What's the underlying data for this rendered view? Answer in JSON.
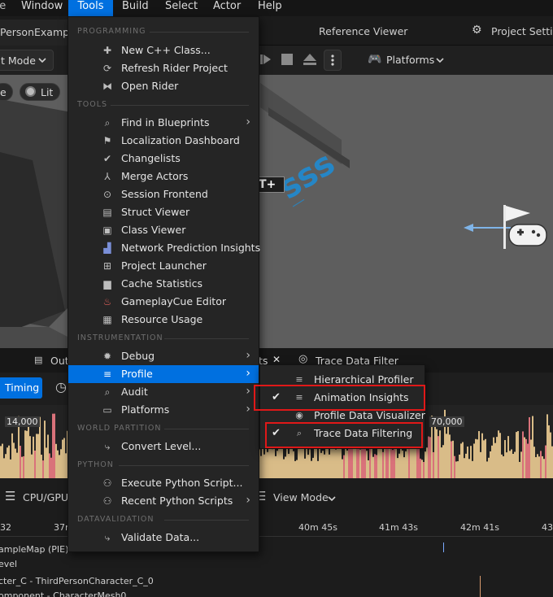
{
  "menubar": {
    "items": [
      {
        "label": "ile"
      },
      {
        "label": "Window"
      },
      {
        "label": "Tools"
      },
      {
        "label": "Build"
      },
      {
        "label": "Select"
      },
      {
        "label": "Actor"
      },
      {
        "label": "Help"
      }
    ]
  },
  "tabs": {
    "level": "PersonExample",
    "reference_viewer": "Reference Viewer",
    "project_settings": "Project Settin"
  },
  "toolbar": {
    "mode": "t Mode",
    "platforms": "Platforms"
  },
  "viewport": {
    "view_e": "e",
    "lit": "Lit",
    "text_bubble": "T+"
  },
  "bottom": {
    "tab_out": "Out",
    "tab_ts": "ts",
    "trace_tab": "Trace Data Filter",
    "timing": "Timing",
    "val_14000": "14,000",
    "val_70000": "70,000",
    "cpu_gpu": "CPU/GPU",
    "view_mode": "View Mode",
    "ticks": [
      "32",
      "37n",
      "40m 45s",
      "41m 43s",
      "42m 41s",
      "43"
    ],
    "rows": [
      "ampleMap (PIE)",
      "evel",
      "cter_C - ThirdPersonCharacter_C_0",
      "omponent - CharacterMesh0"
    ]
  },
  "tools_menu": {
    "sections": {
      "programming": "PROGRAMMING",
      "tools": "TOOLS",
      "instrumentation": "INSTRUMENTATION",
      "world_partition": "WORLD PARTITION",
      "python": "PYTHON",
      "datavalidation": "DATAVALIDATION"
    },
    "items": {
      "new_cpp": "New C++ Class...",
      "refresh_rider": "Refresh Rider Project",
      "open_rider": "Open Rider",
      "find_bp": "Find in Blueprints",
      "loc_dash": "Localization Dashboard",
      "changelists": "Changelists",
      "merge_actors": "Merge Actors",
      "session_frontend": "Session Frontend",
      "struct_viewer": "Struct Viewer",
      "class_viewer": "Class Viewer",
      "net_pred": "Network Prediction Insights",
      "project_launcher": "Project Launcher",
      "cache_stats": "Cache Statistics",
      "gameplaycue": "GameplayCue Editor",
      "resource_usage": "Resource Usage",
      "debug": "Debug",
      "profile": "Profile",
      "audit": "Audit",
      "platforms": "Platforms",
      "convert_level": "Convert Level...",
      "exec_python": "Execute Python Script...",
      "recent_python": "Recent Python Scripts",
      "validate_data": "Validate Data..."
    }
  },
  "profile_submenu": {
    "items": {
      "hier": "Hierarchical Profiler",
      "anim": "Animation Insights",
      "pdv": "Profile Data Visualizer",
      "tdf": "Trace Data Filtering"
    },
    "checked": [
      "Animation Insights",
      "Trace Data Filtering"
    ]
  },
  "colors": {
    "accent": "#0070e0",
    "highlight_box": "#e01818",
    "menu_bg": "#252525",
    "graph_fill": "#d9bc88",
    "graph_spike": "#d9727a"
  }
}
